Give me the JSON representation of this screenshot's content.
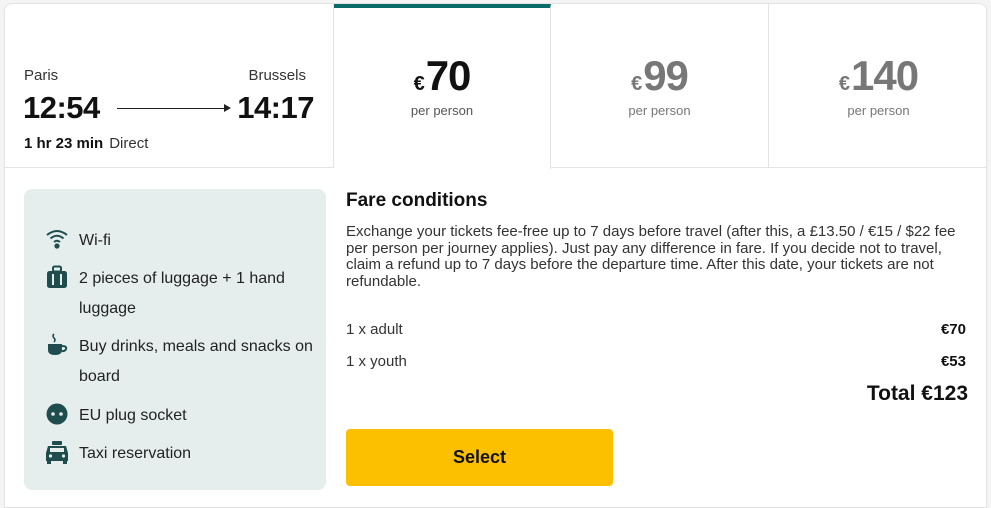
{
  "journey": {
    "from_city": "Paris",
    "to_city": "Brussels",
    "departure_time": "12:54",
    "arrival_time": "14:17",
    "duration": "1 hr 23 min",
    "stops": "Direct"
  },
  "fares": [
    {
      "currency": "€",
      "amount": "70",
      "per": "per person",
      "selected": true
    },
    {
      "currency": "€",
      "amount": "99",
      "per": "per person",
      "selected": false
    },
    {
      "currency": "€",
      "amount": "140",
      "per": "per person",
      "selected": false
    }
  ],
  "amenities": [
    {
      "icon": "wifi-icon",
      "label": "Wi-fi"
    },
    {
      "icon": "luggage-icon",
      "label": "2 pieces of luggage + 1 hand luggage"
    },
    {
      "icon": "coffee-cup-icon",
      "label": "Buy drinks, meals and snacks on board"
    },
    {
      "icon": "plug-socket-icon",
      "label": "EU plug socket"
    },
    {
      "icon": "taxi-icon",
      "label": "Taxi reservation"
    }
  ],
  "conditions": {
    "title": "Fare conditions",
    "text": "Exchange your tickets fee-free up to 7 days before travel (after this, a £13.50 / €15 / $22 fee per person per journey applies). Just pay any difference in fare. If you decide not to travel, claim a refund up to 7 days before the departure time. After this date, your tickets are not refundable.",
    "lines": [
      {
        "label": "1 x adult",
        "amount": "€70"
      },
      {
        "label": "1 x youth",
        "amount": "€53"
      }
    ],
    "total": "Total €123"
  },
  "select_label": "Select",
  "colors": {
    "accent_teal": "#0a6b6b",
    "amenity_bg": "#e6eded",
    "select_yellow": "#fdc000"
  }
}
